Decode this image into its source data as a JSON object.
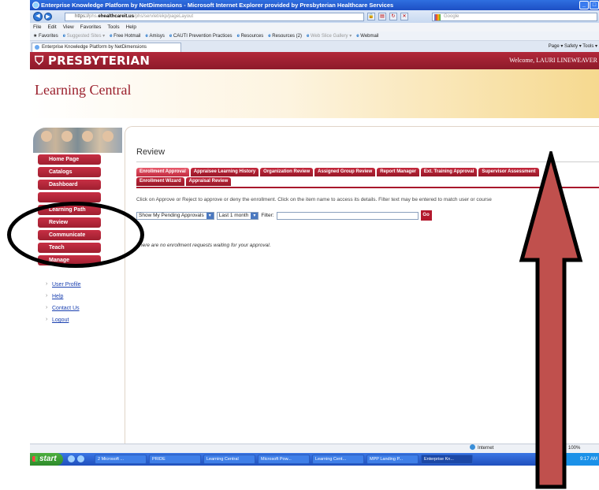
{
  "browser": {
    "window_title": "Enterprise Knowledge Platform by NetDimensions - Microsoft Internet Explorer provided by Presbyterian Healthcare Services",
    "url_prefix": "https://",
    "url_dim1": "phs.",
    "url_domain": "ehealthcareit.us",
    "url_path": "/phs/servlet/ekp/pageLayout",
    "search_placeholder": "Google",
    "menu": [
      "File",
      "Edit",
      "View",
      "Favorites",
      "Tools",
      "Help"
    ],
    "favorites_label": "Favorites",
    "favorites": [
      {
        "label": "Suggested Sites ▾",
        "dim": true
      },
      {
        "label": "Free Hotmail",
        "dim": false
      },
      {
        "label": "Amisys",
        "dim": false
      },
      {
        "label": "CAUTI Prevention Practices",
        "dim": false
      },
      {
        "label": "Resources",
        "dim": false
      },
      {
        "label": "Resources (2)",
        "dim": false
      },
      {
        "label": "Web Slice Gallery ▾",
        "dim": true
      },
      {
        "label": "Webmail",
        "dim": false
      }
    ],
    "tab_label": "Enterprise Knowledge Platform by NetDimensions",
    "tab_tools": "Page ▾   Safety ▾   Tools ▾",
    "status_zone": "Internet",
    "zoom": "100%"
  },
  "header": {
    "brand": "PRESBYTERIAN",
    "welcome": "Welcome, LAURI LINEWEAVER",
    "app_title": "Learning Central"
  },
  "sidebar": {
    "menu": [
      "Home Page",
      "Catalogs",
      "Dashboard",
      "",
      "Learning Path",
      "Review",
      "Communicate",
      "Teach",
      "Manage"
    ],
    "links": [
      "User Profile",
      "Help",
      "Contact Us",
      "Logout"
    ]
  },
  "main": {
    "title": "Review",
    "tabs_row1": [
      "Enrollment Approval",
      "Appraisee Learning History",
      "Organization Review",
      "Assigned Group Review",
      "Report Manager",
      "Ext. Training Approval",
      "Supervisor Assessment"
    ],
    "tabs_row2": [
      "Enrollment Wizard",
      "Appraisal Review"
    ],
    "instructions": "Click on Approve or Reject to approve or deny the enrollment. Click on the item name to access its details. Filter text may be entered to match user or course",
    "filter_approvals": "Show My Pending Approvals",
    "filter_period": "Last 1 month",
    "filter_label": "Filter:",
    "go_label": "Go",
    "empty_message": "There are no enrollment requests waiting for your approval."
  },
  "taskbar": {
    "start_label": "start",
    "tasks": [
      "2 Microsoft ...",
      "PRIDE",
      "Learning Central",
      "Microsoft Pow...",
      "Learning Cent...",
      "MPP Landing P...",
      "Enterprise Kn..."
    ],
    "clock": "9:17 AM"
  },
  "colors": {
    "brand_red": "#a8182c",
    "accent_gold": "#f6d98f",
    "annotation_arrow": "#c0504d"
  }
}
